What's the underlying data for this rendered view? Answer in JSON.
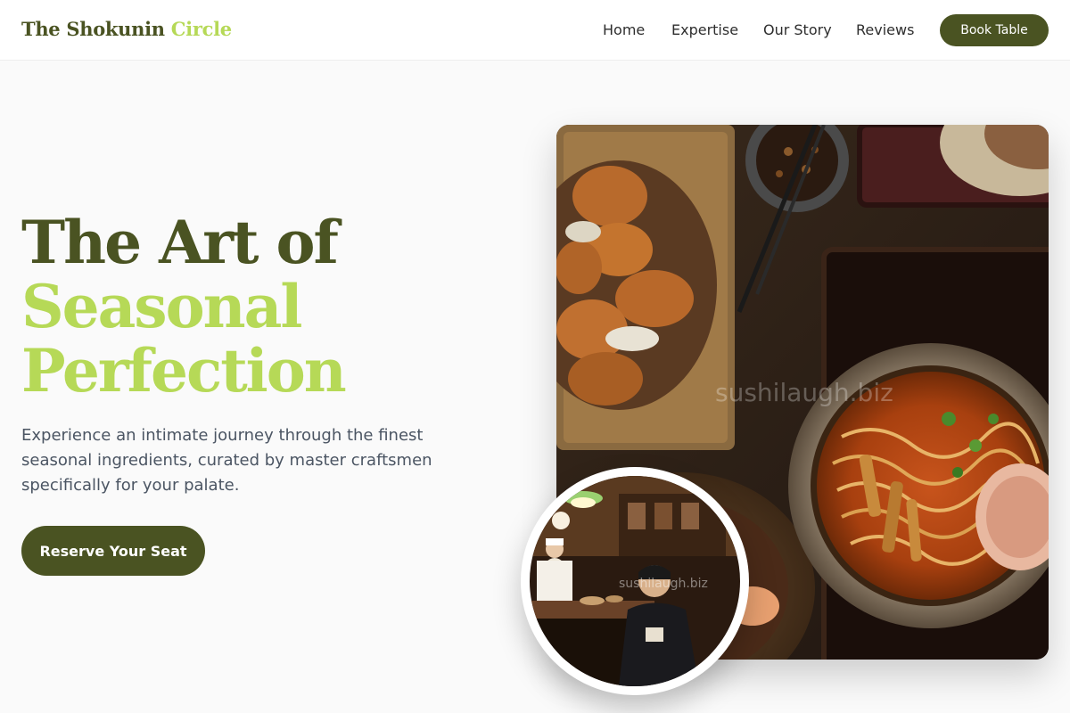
{
  "brand": {
    "name_part1": "The Shokunin",
    "name_part2": "Circle"
  },
  "nav": {
    "links": [
      "Home",
      "Expertise",
      "Our Story",
      "Reviews"
    ],
    "cta_label": "Book Table"
  },
  "hero": {
    "title_line1": "The Art of",
    "title_line2": "Seasonal",
    "title_line3": "Perfection",
    "subtitle": "Experience an intimate journey through the finest seasonal ingredients, curated by master craftsmen specifically for your palate.",
    "cta_label": "Reserve Your Seat"
  },
  "images": {
    "food_watermark": "sushilaugh.biz",
    "restaurant_watermark": "sushilaugh.biz"
  },
  "colors": {
    "brand_dark": "#4a5322",
    "brand_light": "#b6d957",
    "background": "#fafafa"
  }
}
